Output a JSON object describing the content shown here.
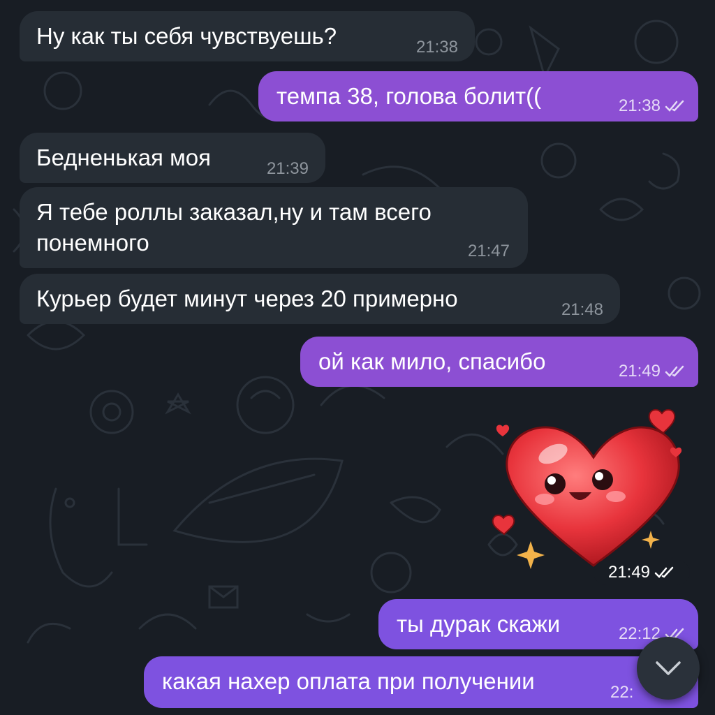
{
  "messages": [
    {
      "id": "m1",
      "direction": "incoming",
      "text": "Ну как ты себя чувствуешь?",
      "time": "21:38"
    },
    {
      "id": "m2",
      "direction": "outgoing",
      "text": "темпа 38, голова болит((",
      "time": "21:38",
      "status": "read"
    },
    {
      "id": "m3",
      "direction": "incoming",
      "text": "Бедненькая моя",
      "time": "21:39"
    },
    {
      "id": "m4",
      "direction": "incoming",
      "lines": [
        "Я тебе роллы заказал,ну и там всего",
        "понемного"
      ],
      "time": "21:47"
    },
    {
      "id": "m5",
      "direction": "incoming",
      "text": "Курьер будет минут через 20 примерно",
      "time": "21:48"
    },
    {
      "id": "m6",
      "direction": "outgoing",
      "text": "ой как мило, спасибо",
      "time": "21:49",
      "status": "read"
    },
    {
      "id": "m7",
      "direction": "outgoing",
      "type": "sticker",
      "sticker": "smiling-heart-sticker",
      "time": "21:49",
      "status": "read"
    },
    {
      "id": "m8",
      "direction": "outgoing",
      "text": "ты дурак скажи",
      "time": "22:12",
      "status": "read"
    },
    {
      "id": "m9",
      "direction": "outgoing",
      "text": "какая нахер оплата при получении",
      "time": "22:",
      "status": "read"
    }
  ],
  "controls": {
    "scroll_down_icon": "chevron-down-icon"
  },
  "colors": {
    "background": "#181d24",
    "incoming_bubble": "#262d35",
    "outgoing_bubble": "#8c4fd3",
    "outgoing_bubble_alt": "#7e52e0",
    "heart": "#e8343c"
  }
}
